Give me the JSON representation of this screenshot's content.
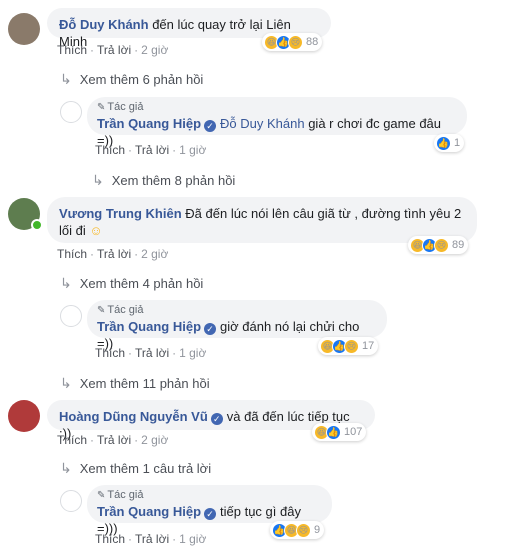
{
  "comments": [
    {
      "author": "Đỗ Duy Khánh",
      "text": "đến lúc quay trở lại Liên Minh",
      "like_label": "Thích",
      "reply_label": "Trả lời",
      "sep": "·",
      "time": "2 giờ",
      "reaction_count": "88",
      "more_replies": "Xem thêm 6 phản hồi",
      "reply": {
        "author_tag": "Tác giả",
        "author": "Trần Quang Hiệp",
        "mention": "Đỗ Duy Khánh",
        "text": "già r chơi đc game đâu =))",
        "like_label": "Thích",
        "reply_label": "Trả lời",
        "time": "1 giờ",
        "reaction_count": "1"
      },
      "after_more": "Xem thêm 8 phản hồi"
    },
    {
      "author": "Vương Trung Khiên",
      "text": "Đã đến lúc nói lên câu giã từ , đường tình yêu 2 lối đi",
      "like_label": "Thích",
      "reply_label": "Trả lời",
      "time": "2 giờ",
      "reaction_count": "89",
      "more_replies": "Xem thêm 4 phản hồi",
      "reply": {
        "author_tag": "Tác giả",
        "author": "Trần Quang Hiệp",
        "text": "giờ đánh nó lại chửi cho =))",
        "like_label": "Thích",
        "reply_label": "Trả lời",
        "time": "1 giờ",
        "reaction_count": "17"
      },
      "after_more": "Xem thêm 11 phản hồi"
    },
    {
      "author": "Hoàng Dũng Nguyễn Vũ",
      "text": "và đã đến lúc tiếp tục :))",
      "like_label": "Thích",
      "reply_label": "Trả lời",
      "time": "2 giờ",
      "reaction_count": "107",
      "more_replies": "Xem thêm 1 câu trả lời",
      "reply": {
        "author_tag": "Tác giả",
        "author": "Trần Quang Hiệp",
        "text": "tiếp tục gì đây =)))",
        "like_label": "Thích",
        "reply_label": "Trả lời",
        "time": "1 giờ",
        "reaction_count": "9"
      }
    }
  ],
  "icons": {
    "reply_arrow": "reply-arrow-icon",
    "pen": "pen-icon",
    "verified": "verified-badge-icon",
    "haha": "haha-reaction-icon",
    "like": "like-reaction-icon",
    "sad": "sad-reaction-icon",
    "emoji": "smiley-emoji-icon"
  },
  "colors": {
    "name": "#385898",
    "bubble": "#f2f3f5",
    "like": "#1877f2",
    "haha": "#f7b928",
    "online": "#42b72a"
  }
}
